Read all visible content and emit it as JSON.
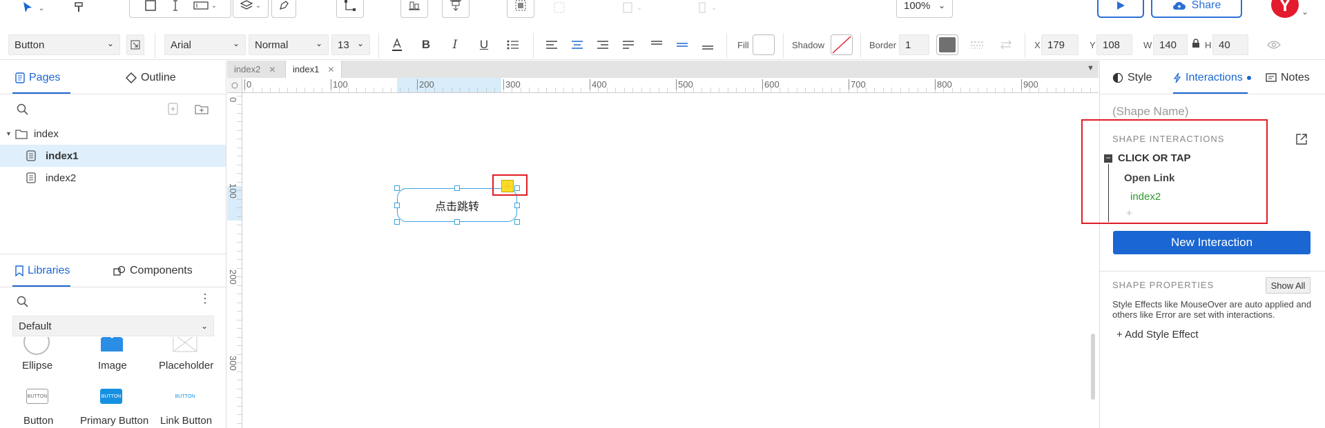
{
  "toolbar": {
    "zoom": "100%",
    "share_label": "Share",
    "avatar_letter": "Y"
  },
  "format_bar": {
    "widget_type": "Button",
    "font_family": "Arial",
    "font_weight": "Normal",
    "font_size": "13",
    "fill_label": "Fill",
    "shadow_label": "Shadow",
    "border_label": "Border",
    "border_width": "1",
    "x_label": "X",
    "x_value": "179",
    "y_label": "Y",
    "y_value": "108",
    "w_label": "W",
    "w_value": "140",
    "h_label": "H",
    "h_value": "40"
  },
  "left_panel": {
    "tabs": [
      {
        "label": "Pages"
      },
      {
        "label": "Outline"
      }
    ],
    "tree": [
      {
        "label": "index",
        "type": "folder"
      },
      {
        "label": "index1",
        "type": "page",
        "selected": true
      },
      {
        "label": "index2",
        "type": "page"
      }
    ],
    "lib_tabs": [
      {
        "label": "Libraries"
      },
      {
        "label": "Components"
      }
    ],
    "library_select": "Default",
    "widgets_row1": [
      {
        "label": "Ellipse"
      },
      {
        "label": "Image"
      },
      {
        "label": "Placeholder"
      }
    ],
    "widgets_row2": [
      {
        "label": "Button"
      },
      {
        "label": "Primary Button"
      },
      {
        "label": "Link Button"
      }
    ],
    "widget_thumb_text": "BUTTON"
  },
  "canvas": {
    "tabs": [
      {
        "label": "index2"
      },
      {
        "label": "index1"
      }
    ],
    "h_ruler": [
      "0",
      "100",
      "200",
      "300",
      "400",
      "500",
      "600",
      "700",
      "800",
      "900"
    ],
    "v_ruler": [
      "0",
      "100",
      "200",
      "300"
    ],
    "shape_text": "点击跳转"
  },
  "right_panel": {
    "tabs": [
      {
        "label": "Style"
      },
      {
        "label": "Interactions"
      },
      {
        "label": "Notes"
      }
    ],
    "shape_name_placeholder": "(Shape Name)",
    "interactions_header": "SHAPE INTERACTIONS",
    "event": "CLICK OR TAP",
    "action": "Open Link",
    "target": "index2",
    "add_symbol": "+",
    "new_interaction_label": "New Interaction",
    "properties_header": "SHAPE PROPERTIES",
    "show_all_label": "Show All",
    "properties_note": "Style Effects like MouseOver are auto applied and others like Error are set with interactions.",
    "add_style_effect": "+ Add Style Effect"
  },
  "colors": {
    "accent": "#1a66d2",
    "selection": "#3aa0dc",
    "highlight_box": "#e01b24",
    "target_green": "#2a9a2a",
    "avatar_red": "#e31b2d"
  }
}
